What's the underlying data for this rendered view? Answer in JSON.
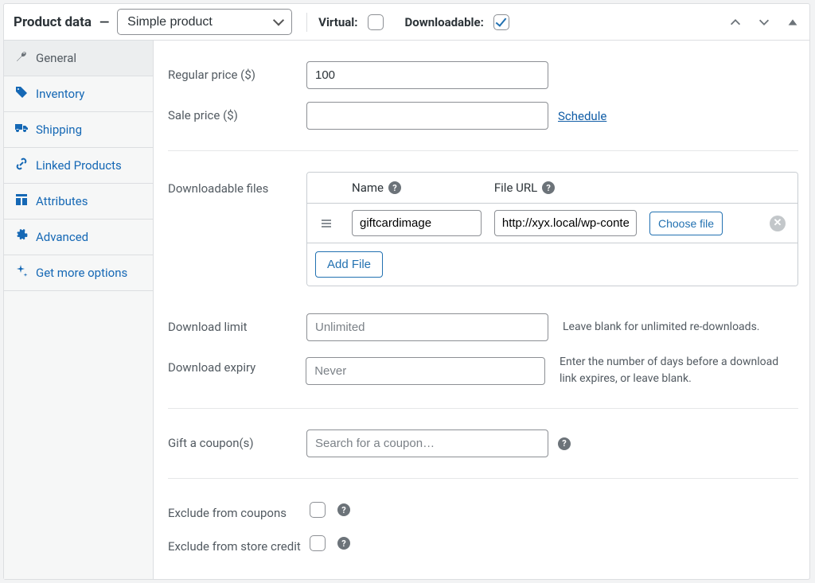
{
  "header": {
    "title": "Product data",
    "dash": "—",
    "product_type": "Simple product",
    "virtual_label": "Virtual:",
    "virtual_checked": false,
    "downloadable_label": "Downloadable:",
    "downloadable_checked": true
  },
  "tabs": [
    {
      "id": "general",
      "label": "General",
      "icon": "wrench",
      "active": true
    },
    {
      "id": "inventory",
      "label": "Inventory",
      "icon": "tag",
      "active": false
    },
    {
      "id": "shipping",
      "label": "Shipping",
      "icon": "truck",
      "active": false
    },
    {
      "id": "linked",
      "label": "Linked Products",
      "icon": "link",
      "active": false
    },
    {
      "id": "attributes",
      "label": "Attributes",
      "icon": "layout",
      "active": false
    },
    {
      "id": "advanced",
      "label": "Advanced",
      "icon": "gear",
      "active": false
    },
    {
      "id": "more",
      "label": "Get more options",
      "icon": "sparkle",
      "active": false
    }
  ],
  "general": {
    "regular_price_label": "Regular price ($)",
    "regular_price_value": "100",
    "sale_price_label": "Sale price ($)",
    "sale_price_value": "",
    "schedule_label": "Schedule",
    "downloadable_files_label": "Downloadable files",
    "dl_table": {
      "name_header": "Name",
      "url_header": "File URL",
      "rows": [
        {
          "name": "giftcardimage",
          "url": "http://xyx.local/wp-content/"
        }
      ],
      "choose_file_label": "Choose file",
      "add_file_label": "Add File"
    },
    "download_limit_label": "Download limit",
    "download_limit_placeholder": "Unlimited",
    "download_limit_hint": "Leave blank for unlimited re-downloads.",
    "download_expiry_label": "Download expiry",
    "download_expiry_placeholder": "Never",
    "download_expiry_hint": "Enter the number of days before a download link expires, or leave blank.",
    "gift_coupons_label": "Gift a coupon(s)",
    "gift_coupons_placeholder": "Search for a coupon…",
    "exclude_coupons_label": "Exclude from coupons",
    "exclude_coupons_checked": false,
    "exclude_store_credit_label": "Exclude from store credit",
    "exclude_store_credit_checked": false
  }
}
